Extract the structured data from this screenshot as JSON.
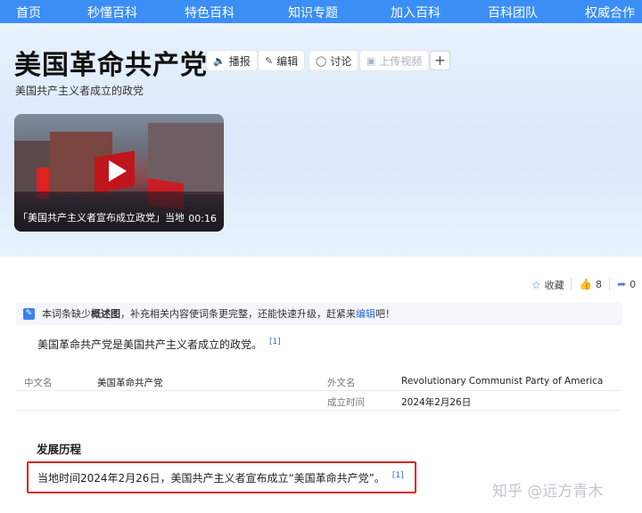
{
  "nav": {
    "items": [
      "首页",
      "秒懂百科",
      "特色百科",
      "知识专题",
      "加入百科",
      "百科团队",
      "权威合作"
    ]
  },
  "header": {
    "title": "美国革命共产党",
    "subtitle": "美国共产主义者成立的政党",
    "tools": {
      "broadcast": "播报",
      "edit": "编辑",
      "discuss": "讨论",
      "upload_video": "上传视频",
      "plus": "+"
    }
  },
  "video": {
    "caption": "「美国共产主义者宣布成立政党」当地时间",
    "duration": "00:16"
  },
  "actions": {
    "collect": "收藏",
    "likes": "8",
    "shares": "0"
  },
  "notice": {
    "prefix": "本词条缺少",
    "strong": "概述图",
    "middle": "，补充相关内容使词条更完整，还能快速升级，赶紧来",
    "link": "编辑",
    "suffix": "吧！"
  },
  "summary": {
    "text": "美国革命共产党是美国共产主义者成立的政党。",
    "ref": "[1]"
  },
  "info": {
    "rows": [
      {
        "label1": "中文名",
        "value1": "美国革命共产党",
        "label2": "外文名",
        "value2": "Revolutionary Communist Party of America"
      },
      {
        "label1": "",
        "value1": "",
        "label2": "成立时间",
        "value2": "2024年2月26日"
      }
    ]
  },
  "history": {
    "heading": "发展历程",
    "text": "当地时间2024年2月26日，美国共产主义者宣布成立“美国革命共产党”。",
    "ref": "[1]"
  },
  "watermark": "知乎 @远方青木",
  "colors": {
    "nav_bg": "#3a8ef6",
    "link": "#2a6ad4",
    "highlight_border": "#e02020"
  }
}
